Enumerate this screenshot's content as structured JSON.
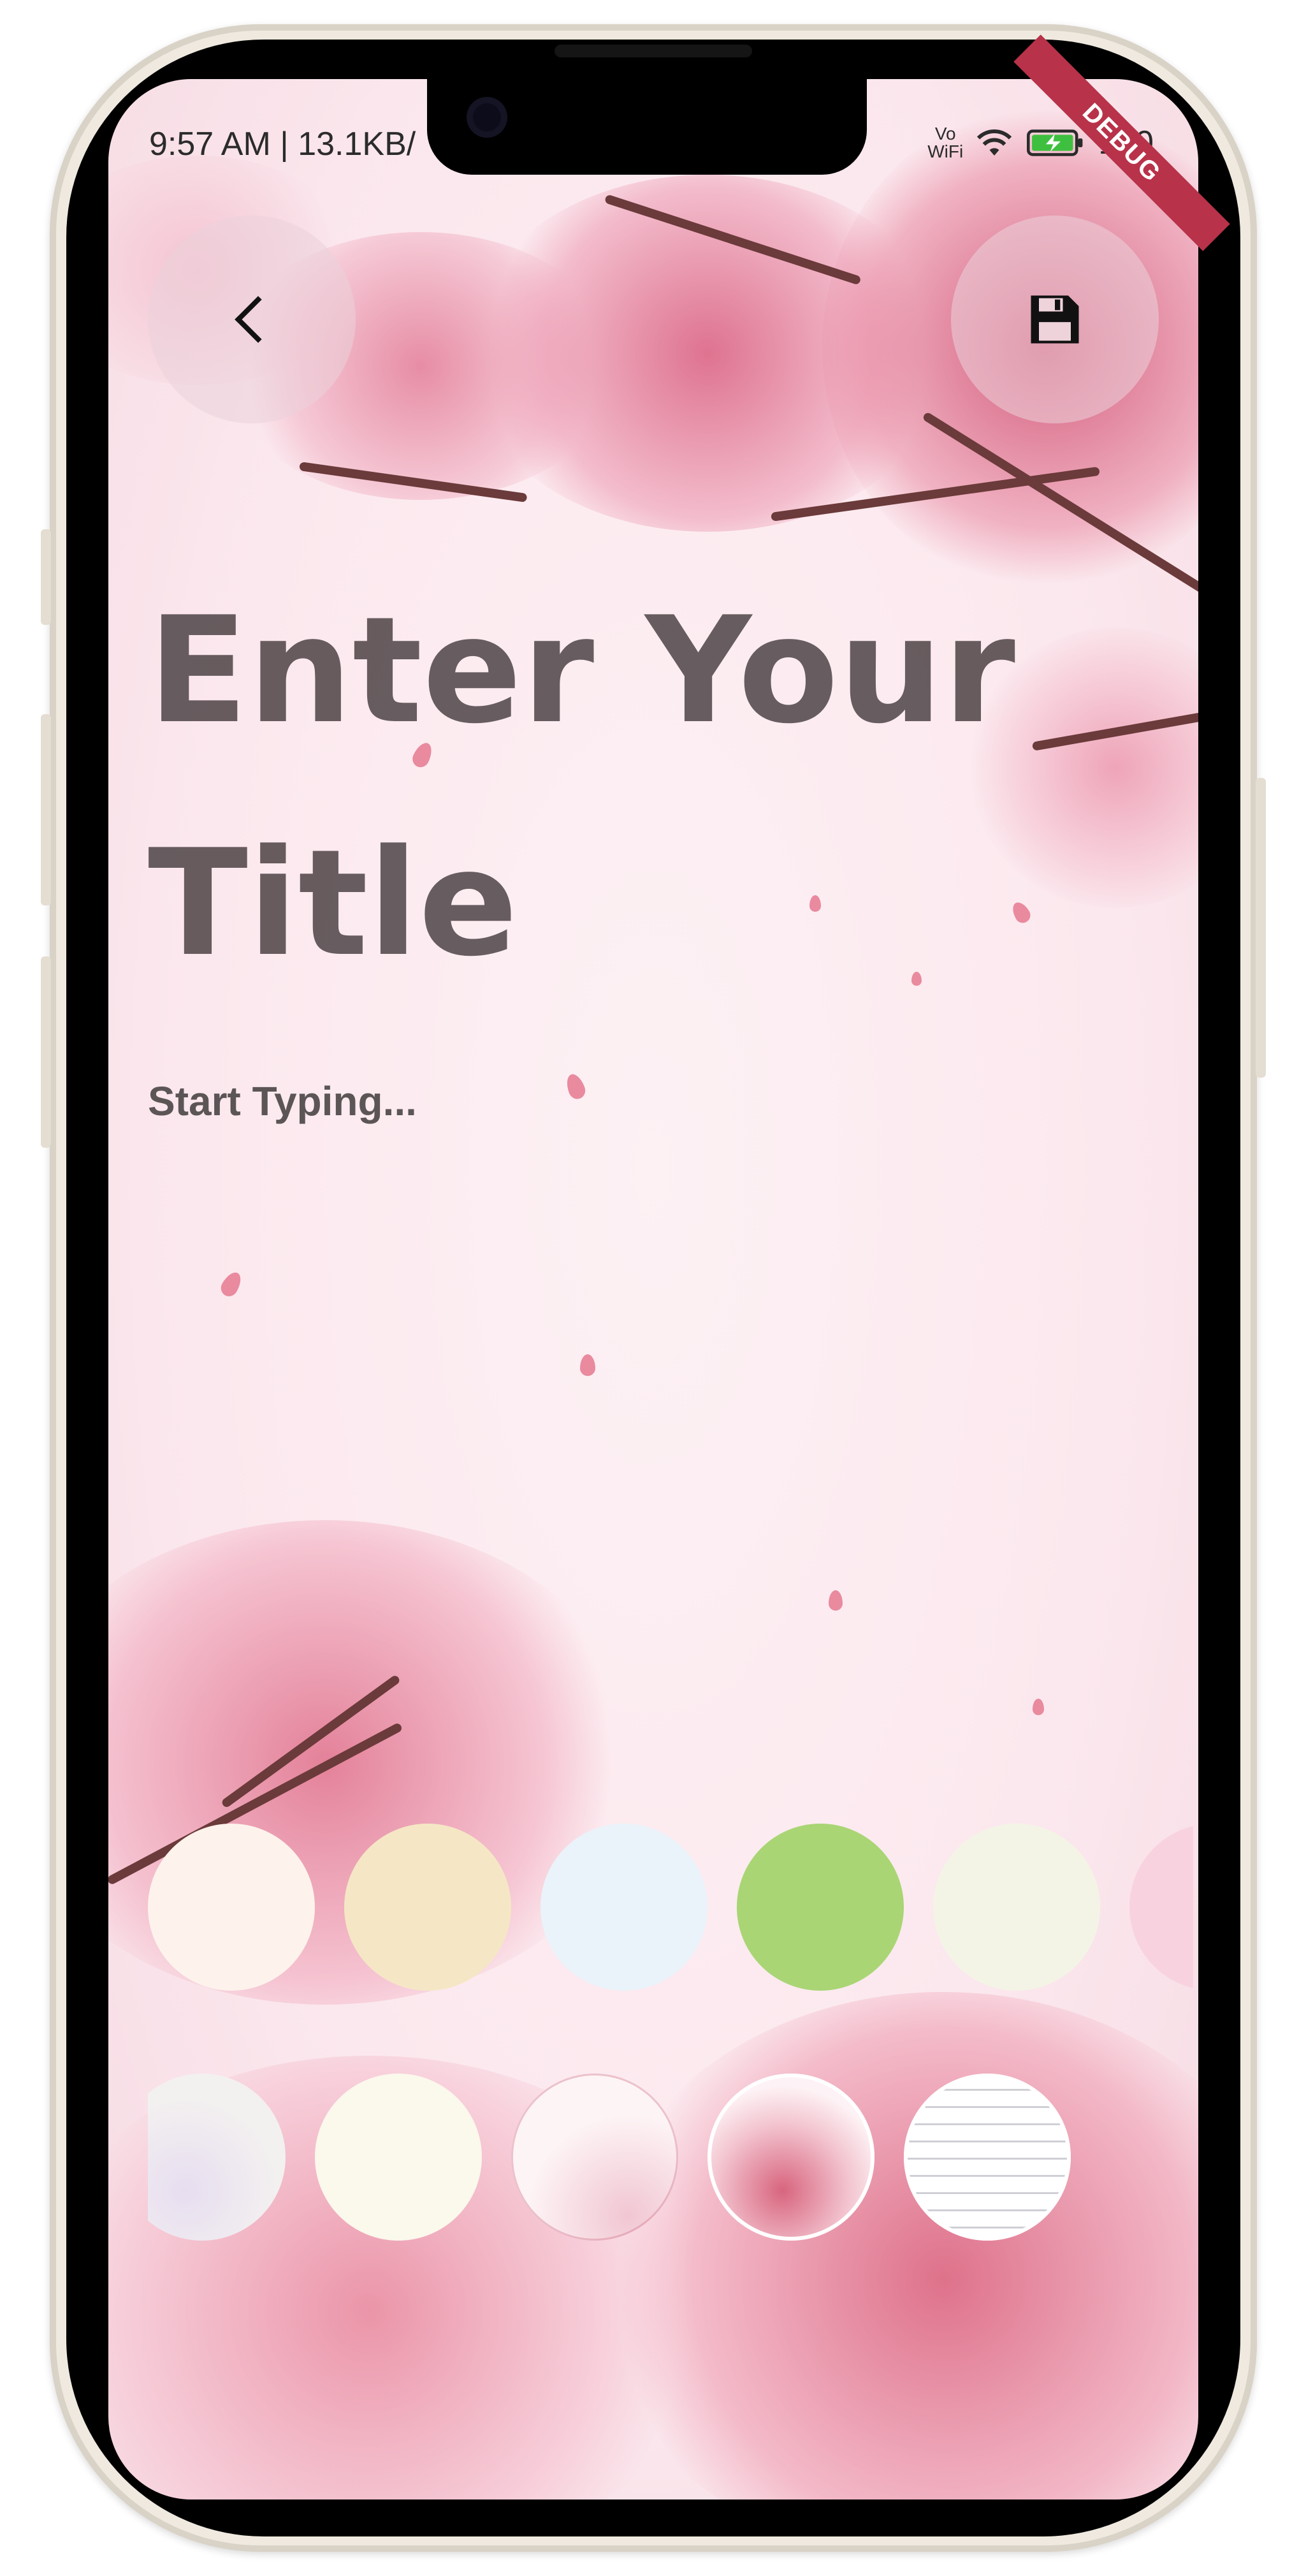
{
  "status_bar": {
    "time": "9:57 AM | 13.1KB/",
    "network_vo": "Vo",
    "network_wifi": "WiFi",
    "battery": "100",
    "debug_banner": "DEBUG"
  },
  "toolbar": {
    "back_icon": "chevron-left-icon",
    "save_icon": "floppy-disk-icon"
  },
  "note": {
    "title_placeholder": "Enter Your Title",
    "body_placeholder": "Start Typing..."
  },
  "colors": {
    "swatches": [
      "#fdf3ec",
      "#f5e7c5",
      "#eaf3fa",
      "#a9d574",
      "#f4f4e6",
      "#f8d3df"
    ],
    "title": "#463c3e",
    "blossom": "#e07a93"
  },
  "backgrounds": [
    "lavender-floral",
    "cream",
    "cherry-sketch",
    "cherry-blossom",
    "lined-paper"
  ]
}
